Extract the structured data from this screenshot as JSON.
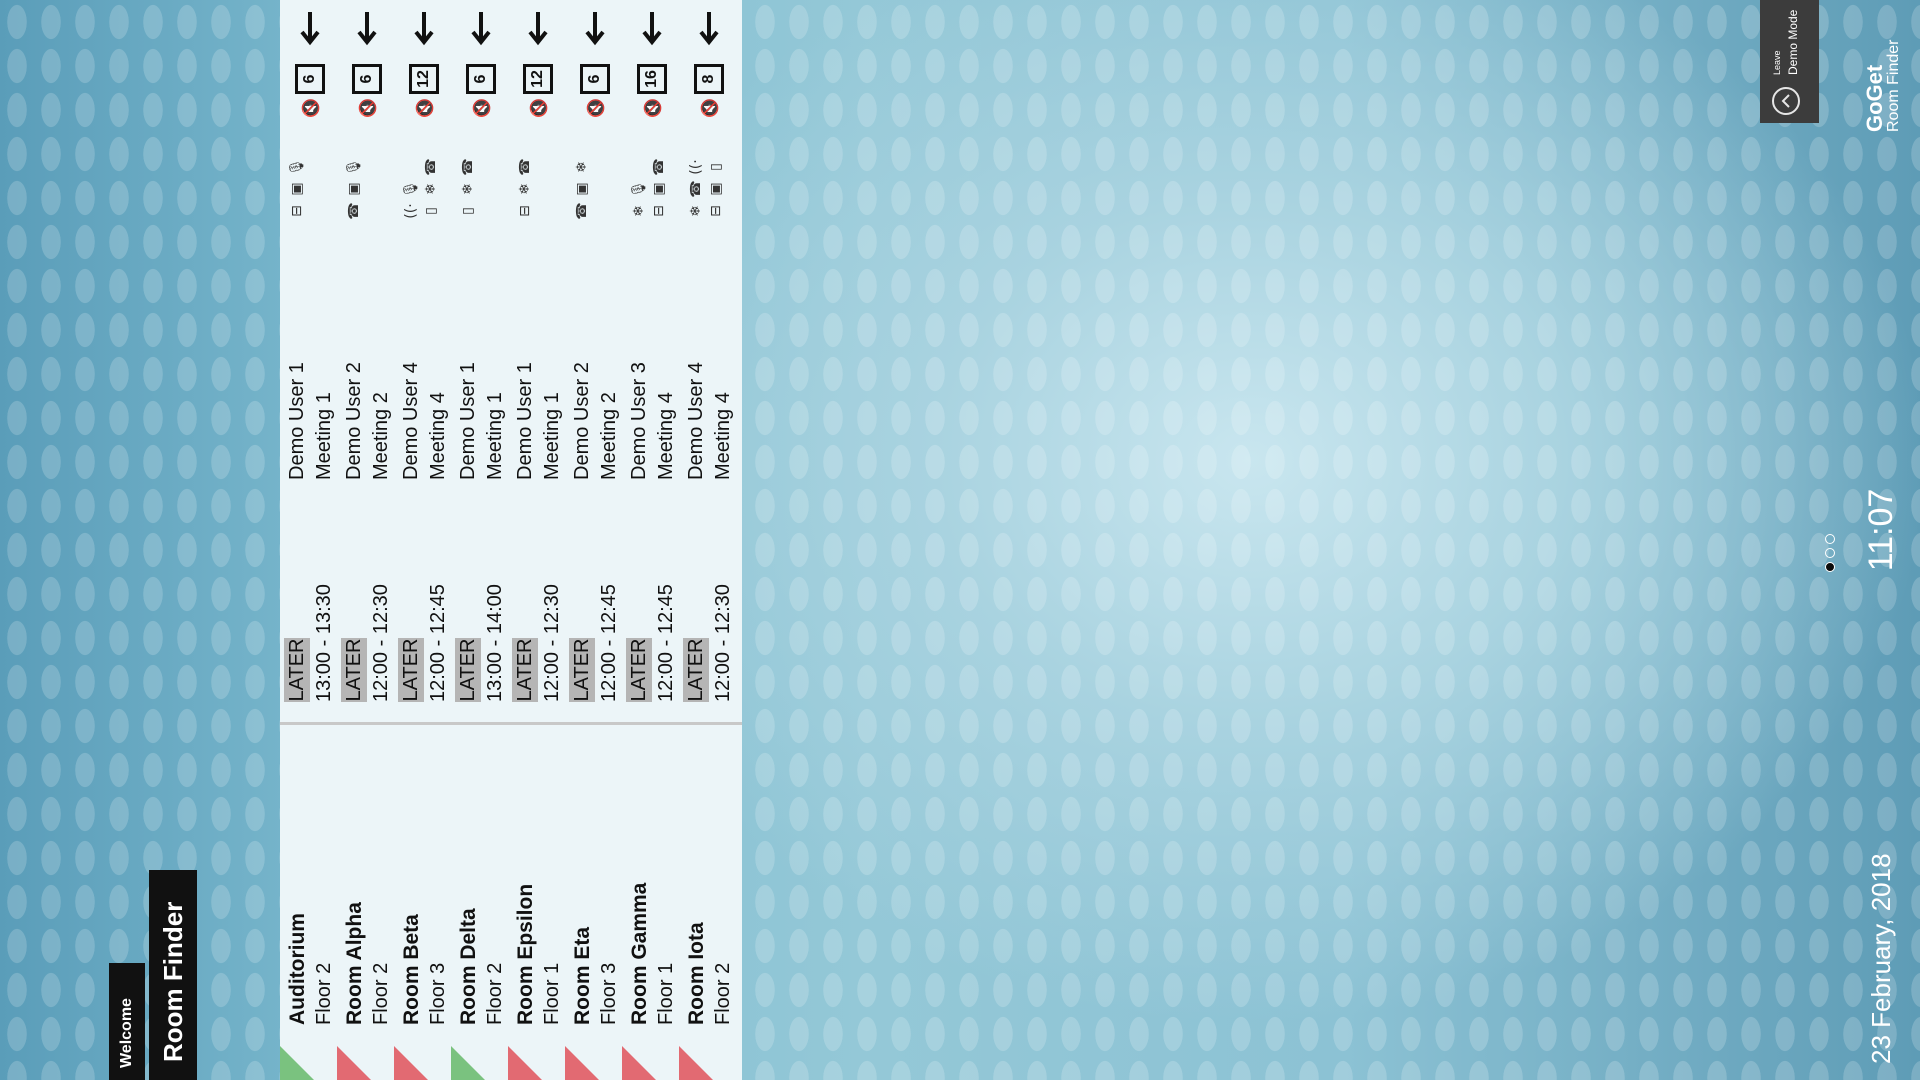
{
  "header": {
    "date": "23 February, 2018",
    "clock": "11:07",
    "brand_name": "GoGet",
    "brand_sub": "Room Finder",
    "leave_demo_line1": "Leave",
    "leave_demo_line2": "Demo Mode",
    "pager_active": 1,
    "pager_count": 3
  },
  "tabs": {
    "welcome": "Welcome",
    "room_finder": "Room Finder"
  },
  "status_label": "LATER",
  "rooms": [
    {
      "name": "Auditorium",
      "floor": "Floor 2",
      "status_color": "green",
      "status": "LATER",
      "time": "13:00 - 13:30",
      "user": "Demo User 1",
      "meeting": "Meeting 1",
      "capacity": "6",
      "equipment": [
        "projector-icon",
        "tv-icon",
        "mic-icon"
      ]
    },
    {
      "name": "Room Alpha",
      "floor": "Floor 2",
      "status_color": "red",
      "status": "LATER",
      "time": "12:00 - 12:30",
      "user": "Demo User 2",
      "meeting": "Meeting 2",
      "capacity": "6",
      "equipment": [
        "phone-icon",
        "tv-icon",
        "mic-icon"
      ]
    },
    {
      "name": "Room Beta",
      "floor": "Floor 3",
      "status_color": "red",
      "status": "LATER",
      "time": "12:00 - 12:45",
      "user": "Demo User 4",
      "meeting": "Meeting 4",
      "capacity": "12",
      "equipment": [
        "screen-icon",
        "snowflake-icon",
        "phone-icon",
        "wifi-icon",
        "mic-icon"
      ]
    },
    {
      "name": "Room Delta",
      "floor": "Floor 2",
      "status_color": "green",
      "status": "LATER",
      "time": "13:00 - 14:00",
      "user": "Demo User 1",
      "meeting": "Meeting 1",
      "capacity": "6",
      "equipment": [
        "screen-icon",
        "snowflake-icon",
        "phone-icon"
      ]
    },
    {
      "name": "Room Epsilon",
      "floor": "Floor 1",
      "status_color": "red",
      "status": "LATER",
      "time": "12:00 - 12:30",
      "user": "Demo User 1",
      "meeting": "Meeting 1",
      "capacity": "12",
      "equipment": [
        "projector-icon",
        "snowflake-icon",
        "phone-icon"
      ]
    },
    {
      "name": "Room Eta",
      "floor": "Floor 3",
      "status_color": "red",
      "status": "LATER",
      "time": "12:00 - 12:45",
      "user": "Demo User 2",
      "meeting": "Meeting 2",
      "capacity": "6",
      "equipment": [
        "phone-icon",
        "tv-icon",
        "snowflake-icon"
      ]
    },
    {
      "name": "Room Gamma",
      "floor": "Floor 1",
      "status_color": "red",
      "status": "LATER",
      "time": "12:00 - 12:45",
      "user": "Demo User 3",
      "meeting": "Meeting 4",
      "capacity": "16",
      "equipment": [
        "projector-icon",
        "tv-icon",
        "phone-icon",
        "snowflake-icon",
        "mic-icon"
      ]
    },
    {
      "name": "Room Iota",
      "floor": "Floor 2",
      "status_color": "red",
      "status": "LATER",
      "time": "12:00 - 12:30",
      "user": "Demo User 4",
      "meeting": "Meeting 4",
      "capacity": "8",
      "equipment": [
        "projector-icon",
        "tv-icon",
        "screen-icon",
        "snowflake-icon",
        "phone-icon",
        "wifi-icon"
      ]
    }
  ],
  "colors": {
    "status_red": "#e26a72",
    "status_green": "#7ac27f",
    "tab_bg": "#111111",
    "badge_bg": "#b5b5b5",
    "row_bg": "#ecf5f8"
  }
}
